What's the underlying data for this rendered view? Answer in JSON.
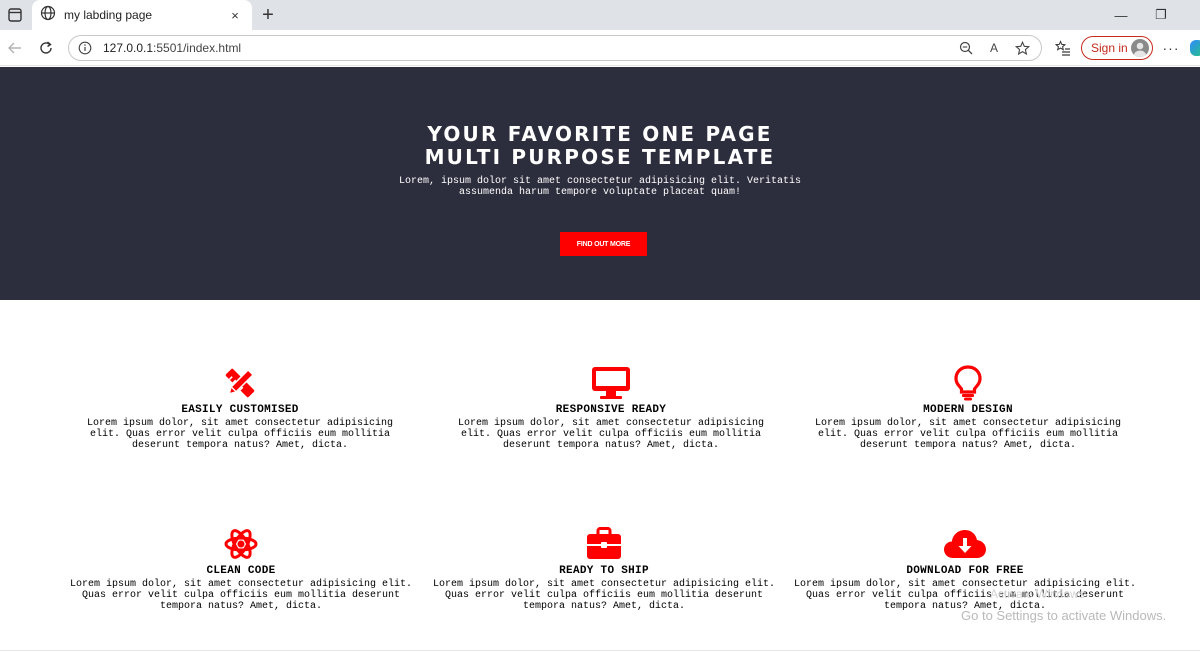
{
  "browser": {
    "tab": {
      "title": "my labding page",
      "close_icon": "×"
    },
    "new_tab_icon": "+",
    "window_controls": {
      "minimize": "—",
      "restore": "❐"
    },
    "address": {
      "host": "127.0.0.1",
      "path": ":5501/index.html"
    },
    "read_aloud_label": "A",
    "sign_in_label": "Sign in",
    "more_label": "···"
  },
  "hero": {
    "title_line1": "YOUR FAVORITE ONE PAGE",
    "title_line2": "MULTI PURPOSE TEMPLATE",
    "subtitle_line1": "Lorem, ipsum dolor sit amet consectetur adipisicing elit. Veritatis",
    "subtitle_line2": "assumenda harum tempore voluptate placeat quam!",
    "button_label": "FIND OUT MORE",
    "accent_color": "#ff0000",
    "background_color": "#2d2e3d"
  },
  "features": [
    {
      "icon": "pencil-ruler-icon",
      "title": "EASILY CUSTOMISED",
      "lines": [
        "Lorem ipsum dolor, sit amet consectetur adipisicing",
        "elit. Quas error velit culpa officiis eum mollitia",
        "deserunt tempora natus? Amet, dicta."
      ]
    },
    {
      "icon": "desktop-icon",
      "title": "RESPONSIVE READY",
      "lines": [
        "Lorem ipsum dolor, sit amet consectetur adipisicing",
        "elit. Quas error velit culpa officiis eum mollitia",
        "deserunt tempora natus? Amet, dicta."
      ]
    },
    {
      "icon": "lightbulb-icon",
      "title": "MODERN DESIGN",
      "lines": [
        "Lorem ipsum dolor, sit amet consectetur adipisicing",
        "elit. Quas error velit culpa officiis eum mollitia",
        "deserunt tempora natus? Amet, dicta."
      ]
    },
    {
      "icon": "atom-icon",
      "title": "CLEAN CODE",
      "lines": [
        "Lorem ipsum dolor, sit amet consectetur adipisicing elit.",
        "Quas error velit culpa officiis eum mollitia deserunt",
        "tempora natus? Amet, dicta."
      ]
    },
    {
      "icon": "briefcase-icon",
      "title": "READY TO SHIP",
      "lines": [
        "Lorem ipsum dolor, sit amet consectetur adipisicing elit.",
        "Quas error velit culpa officiis eum mollitia deserunt",
        "tempora natus? Amet, dicta."
      ]
    },
    {
      "icon": "cloud-download-icon",
      "title": "DOWNLOAD FOR FREE",
      "lines": [
        "Lorem ipsum dolor, sit amet consectetur adipisicing elit.",
        "Quas error velit culpa officiis eum mollitia deserunt",
        "tempora natus? Amet, dicta."
      ]
    }
  ],
  "os_watermark": {
    "line1": "Activate Windows",
    "line2": "Go to Settings to activate Windows."
  }
}
